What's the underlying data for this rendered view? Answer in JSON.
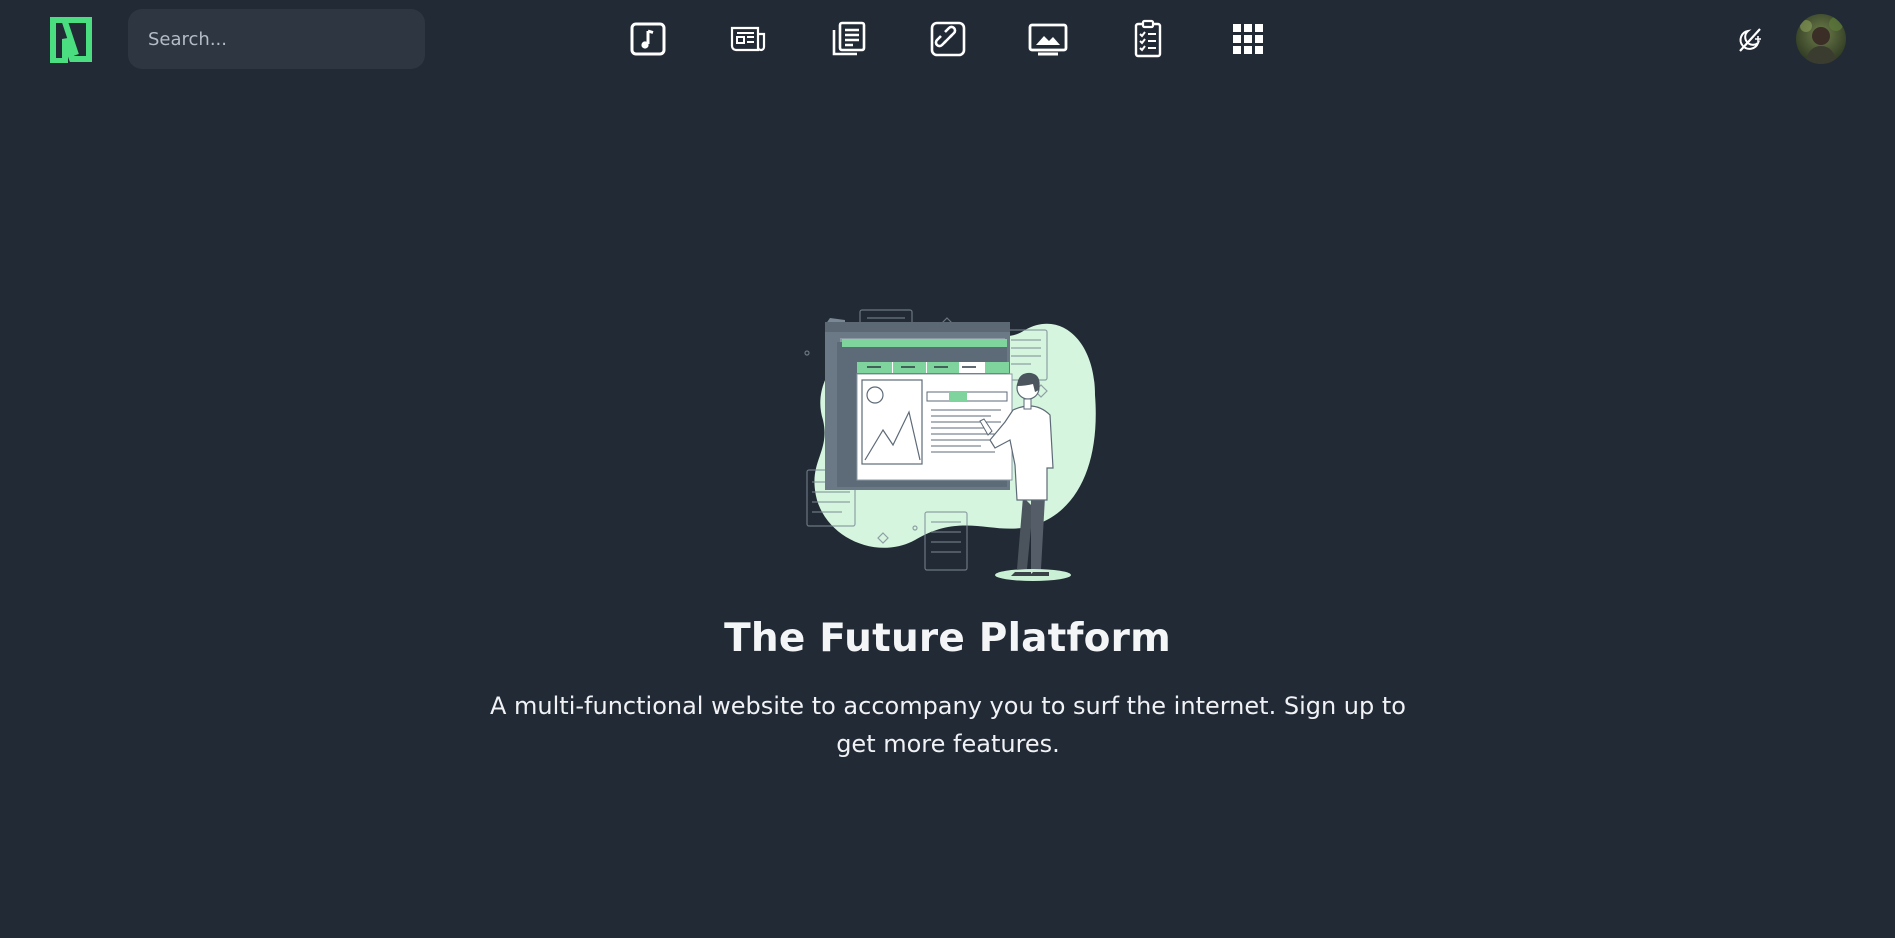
{
  "brand": {
    "accent_color": "#4ade80",
    "logo_icon": "n-logo-icon"
  },
  "search": {
    "placeholder": "Search...",
    "value": ""
  },
  "nav": {
    "items": [
      {
        "name": "music",
        "icon": "music-note-icon"
      },
      {
        "name": "news",
        "icon": "newspaper-icon"
      },
      {
        "name": "documents",
        "icon": "documents-icon"
      },
      {
        "name": "links",
        "icon": "link-icon"
      },
      {
        "name": "images",
        "icon": "image-icon"
      },
      {
        "name": "tasks",
        "icon": "clipboard-checklist-icon"
      },
      {
        "name": "apps",
        "icon": "grid-apps-icon"
      }
    ]
  },
  "header_right": {
    "theme_toggle_icon": "theme-toggle-icon",
    "avatar": "user-avatar"
  },
  "hero": {
    "illustration": "person-at-dashboard-illustration",
    "title": "The Future Platform",
    "subtitle": "A multi-functional website to accompany you to surf the internet. Sign up to get more features."
  },
  "colors": {
    "background": "#222a35",
    "search_bg": "#2e3641",
    "illustration_blob": "#d5f5df",
    "illustration_green": "#7ed49c"
  }
}
